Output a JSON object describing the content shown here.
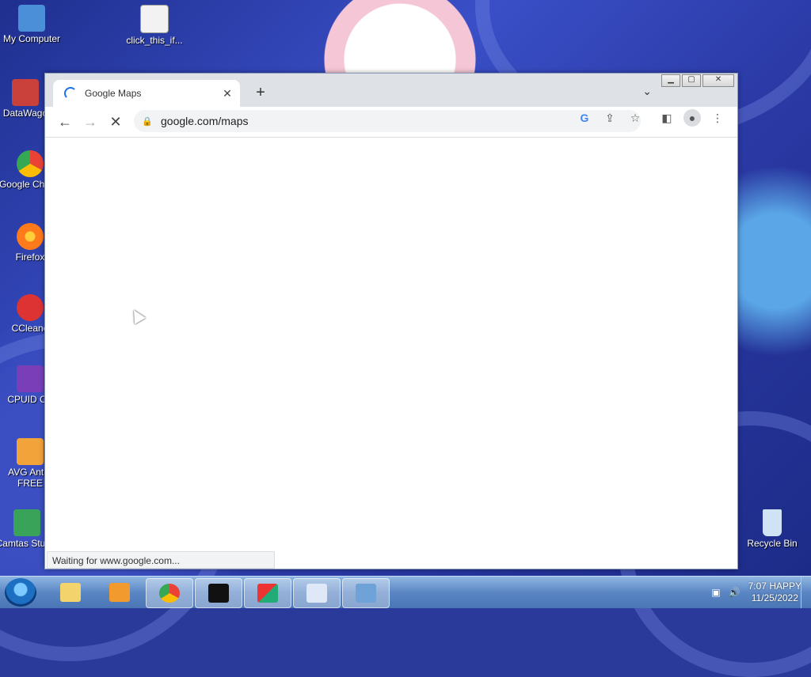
{
  "desktop": {
    "icons": [
      {
        "label": "My Computer",
        "icon": "computer-icon",
        "color": "#4a8fd8"
      },
      {
        "label": "click_this_if...",
        "icon": "script-file-icon",
        "color": "#f2f2f2"
      },
      {
        "label": "DataWago",
        "icon": "shortcut-icon",
        "color": "#c9413a"
      },
      {
        "label": "Google Chrom",
        "icon": "chrome-icon",
        "color": "#34a853"
      },
      {
        "label": "Firefox",
        "icon": "firefox-icon",
        "color": "#ff7a1a"
      },
      {
        "label": "CCleane",
        "icon": "ccleaner-icon",
        "color": "#d33"
      },
      {
        "label": "CPUID CP",
        "icon": "cpuid-icon",
        "color": "#7a3fb8"
      },
      {
        "label": "AVG AntiV FREE",
        "icon": "avg-icon",
        "color": "#f2a33a"
      },
      {
        "label": "Camtas Studio",
        "icon": "camtasia-icon",
        "color": "#3aa35a"
      },
      {
        "label": "Recycle Bin",
        "icon": "recycle-bin-icon",
        "color": "#cfe3f5"
      }
    ]
  },
  "browser": {
    "tab_title": "Google Maps",
    "url": "google.com/maps",
    "status_text": "Waiting for www.google.com...",
    "new_tab_symbol": "+",
    "close_tab_symbol": "✕",
    "tab_menu_symbol": "⌄"
  },
  "taskbar": {
    "clock_time": "7:07 HAPPY",
    "clock_date": "11/25/2022",
    "items": [
      {
        "icon": "file-explorer-icon",
        "active": false
      },
      {
        "icon": "media-player-icon",
        "active": false
      },
      {
        "icon": "chrome-icon",
        "active": true
      },
      {
        "icon": "command-prompt-icon",
        "active": false
      },
      {
        "icon": "app-icon",
        "active": false
      },
      {
        "icon": "notepad-icon",
        "active": false
      },
      {
        "icon": "control-panel-icon",
        "active": false
      }
    ]
  },
  "colors": {
    "accent": "#1a73e8",
    "taskbar": "#5b86c4"
  }
}
